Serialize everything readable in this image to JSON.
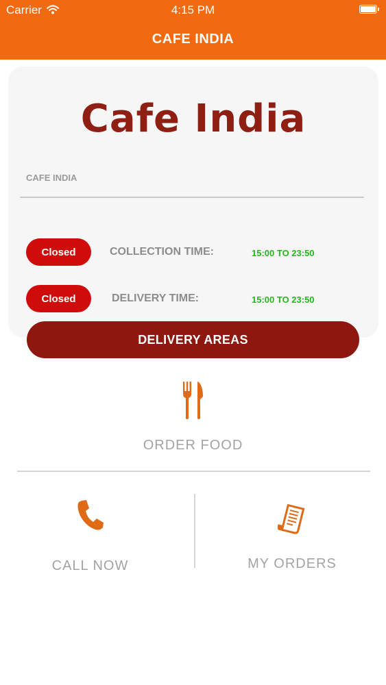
{
  "status_bar": {
    "carrier": "Carrier",
    "time": "4:15 PM",
    "icons": [
      "wifi-icon",
      "battery-icon"
    ]
  },
  "header": {
    "title": "CAFE INDIA",
    "background": "#f26a0f"
  },
  "info_card": {
    "logo_text": "Cafe India",
    "restaurant_name": "CAFE INDIA",
    "schedules": [
      {
        "status": "Closed",
        "label": "COLLECTION TIME:",
        "hours": "15:00 TO 23:50"
      },
      {
        "status": "Closed",
        "label": "DELIVERY TIME:",
        "hours": "15:00 TO 23:50"
      }
    ]
  },
  "delivery_areas_button": {
    "label": "DELIVERY AREAS"
  },
  "actions": {
    "order_food": {
      "label": "ORDER FOOD",
      "icon": "fork-knife-icon"
    },
    "call_now": {
      "label": "CALL NOW",
      "icon": "phone-icon"
    },
    "my_orders": {
      "label": "MY ORDERS",
      "icon": "receipt-icon"
    }
  },
  "colors": {
    "accent": "#f26a0f",
    "brand_dark_red": "#8e180f",
    "closed_badge": "#cf0c0c",
    "hours_green": "#26b61f",
    "icon_orange": "#e06b17"
  }
}
